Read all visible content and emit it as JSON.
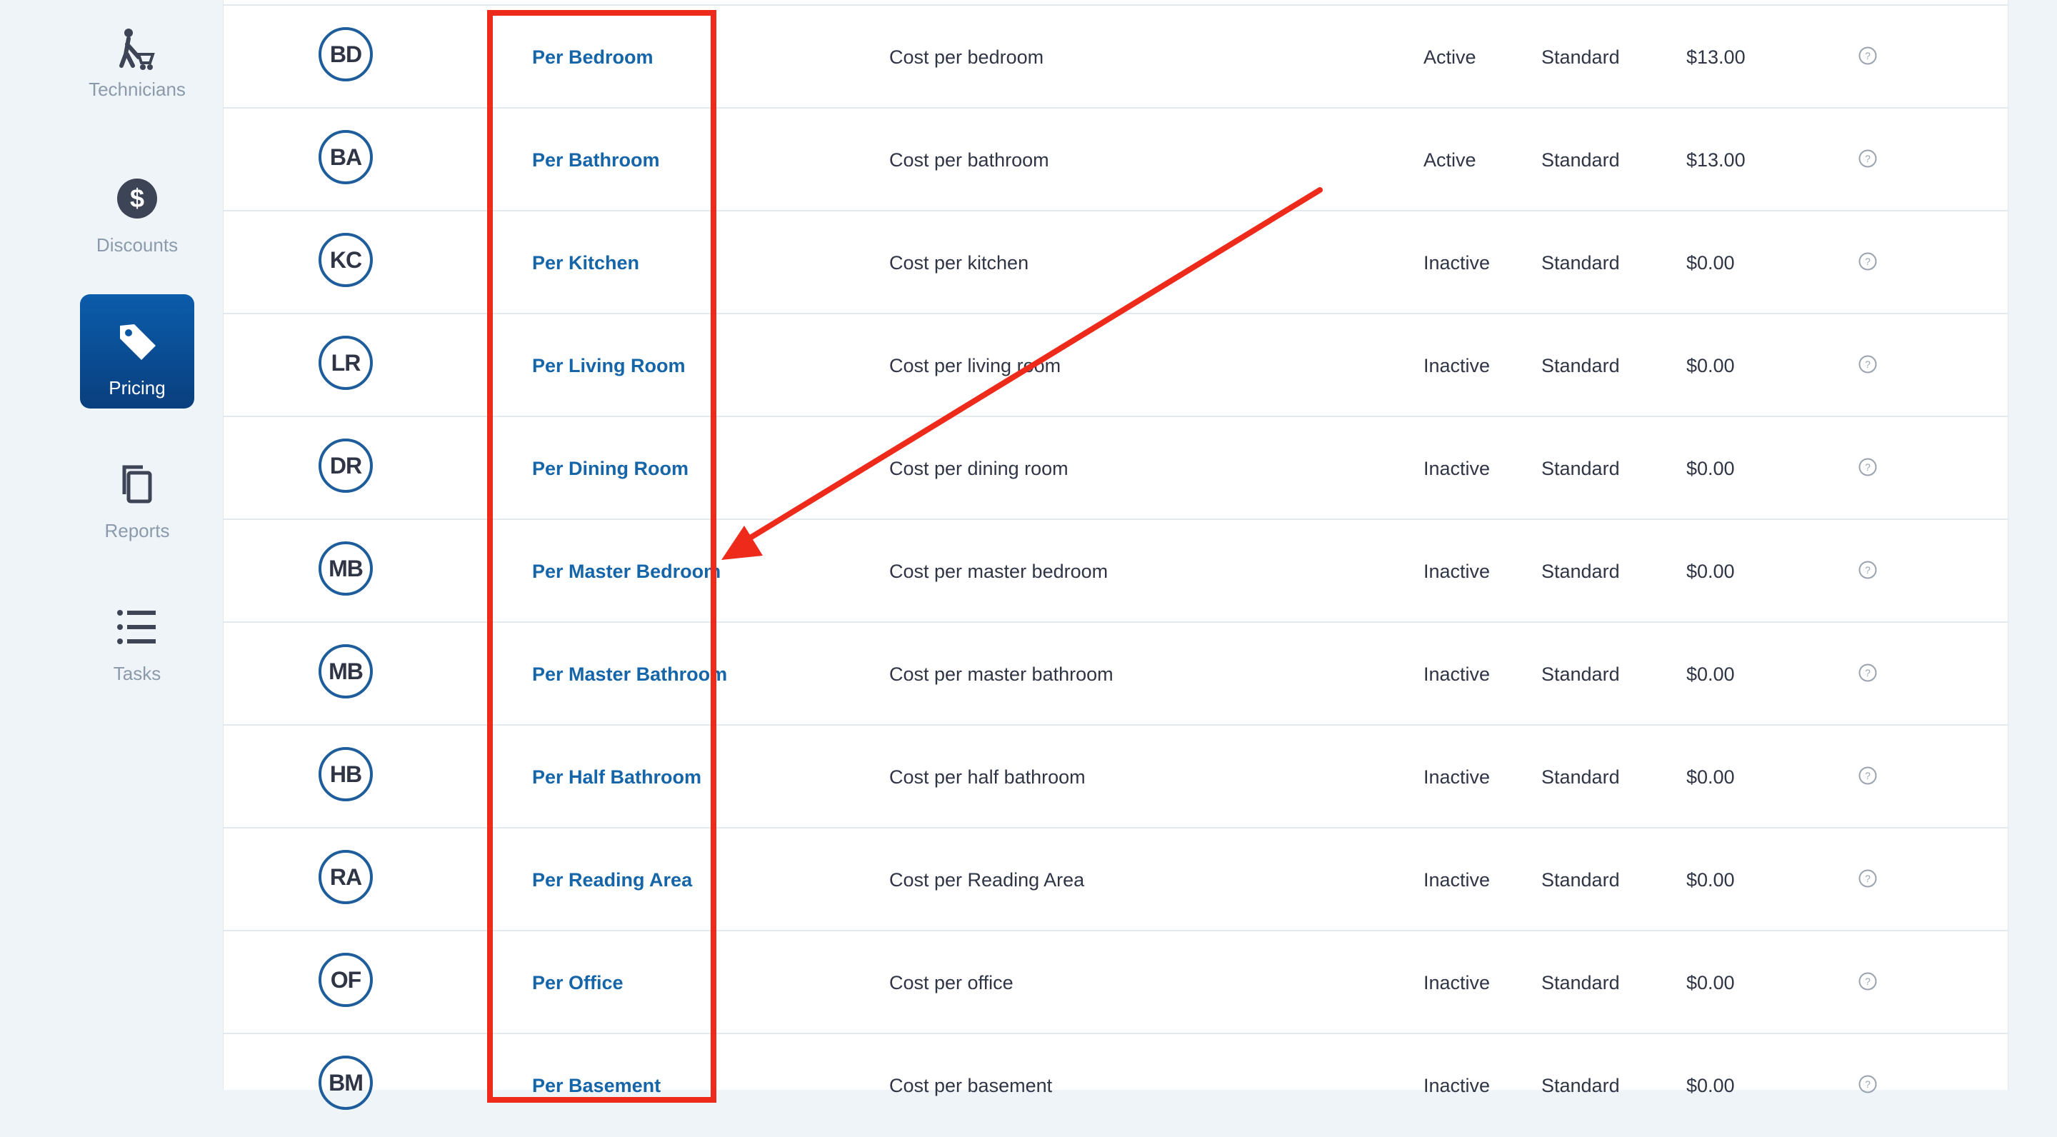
{
  "sidebar": {
    "items": [
      {
        "label": "Technicians",
        "icon": "technician-icon",
        "active": false
      },
      {
        "label": "Discounts",
        "icon": "dollar-icon",
        "active": false
      },
      {
        "label": "Pricing",
        "icon": "price-tag-icon",
        "active": true
      },
      {
        "label": "Reports",
        "icon": "copy-icon",
        "active": false
      },
      {
        "label": "Tasks",
        "icon": "list-icon",
        "active": false
      }
    ]
  },
  "pricing_table": {
    "rows": [
      {
        "code": "BD",
        "name": "Per Bedroom",
        "description": "Cost per bedroom",
        "status": "Active",
        "type": "Standard",
        "price": "$13.00"
      },
      {
        "code": "BA",
        "name": "Per Bathroom",
        "description": "Cost per bathroom",
        "status": "Active",
        "type": "Standard",
        "price": "$13.00"
      },
      {
        "code": "KC",
        "name": "Per Kitchen",
        "description": "Cost per kitchen",
        "status": "Inactive",
        "type": "Standard",
        "price": "$0.00"
      },
      {
        "code": "LR",
        "name": "Per Living Room",
        "description": "Cost per living room",
        "status": "Inactive",
        "type": "Standard",
        "price": "$0.00"
      },
      {
        "code": "DR",
        "name": "Per Dining Room",
        "description": "Cost per dining room",
        "status": "Inactive",
        "type": "Standard",
        "price": "$0.00"
      },
      {
        "code": "MB",
        "name": "Per Master Bedroom",
        "description": "Cost per master bedroom",
        "status": "Inactive",
        "type": "Standard",
        "price": "$0.00"
      },
      {
        "code": "MB",
        "name": "Per Master Bathroom",
        "description": "Cost per master bathroom",
        "status": "Inactive",
        "type": "Standard",
        "price": "$0.00"
      },
      {
        "code": "HB",
        "name": "Per Half Bathroom",
        "description": "Cost per half bathroom",
        "status": "Inactive",
        "type": "Standard",
        "price": "$0.00"
      },
      {
        "code": "RA",
        "name": "Per Reading Area",
        "description": "Cost per Reading Area",
        "status": "Inactive",
        "type": "Standard",
        "price": "$0.00"
      },
      {
        "code": "OF",
        "name": "Per Office",
        "description": "Cost per office",
        "status": "Inactive",
        "type": "Standard",
        "price": "$0.00"
      },
      {
        "code": "BM",
        "name": "Per Basement",
        "description": "Cost per basement",
        "status": "Inactive",
        "type": "Standard",
        "price": "$0.00"
      }
    ],
    "help_icon": "question-circle-icon"
  },
  "colors": {
    "accent": "#1565a8",
    "badge_border": "#1d5d9b",
    "active_nav": "#0b5cab",
    "annotation": "#ee2a1b"
  }
}
